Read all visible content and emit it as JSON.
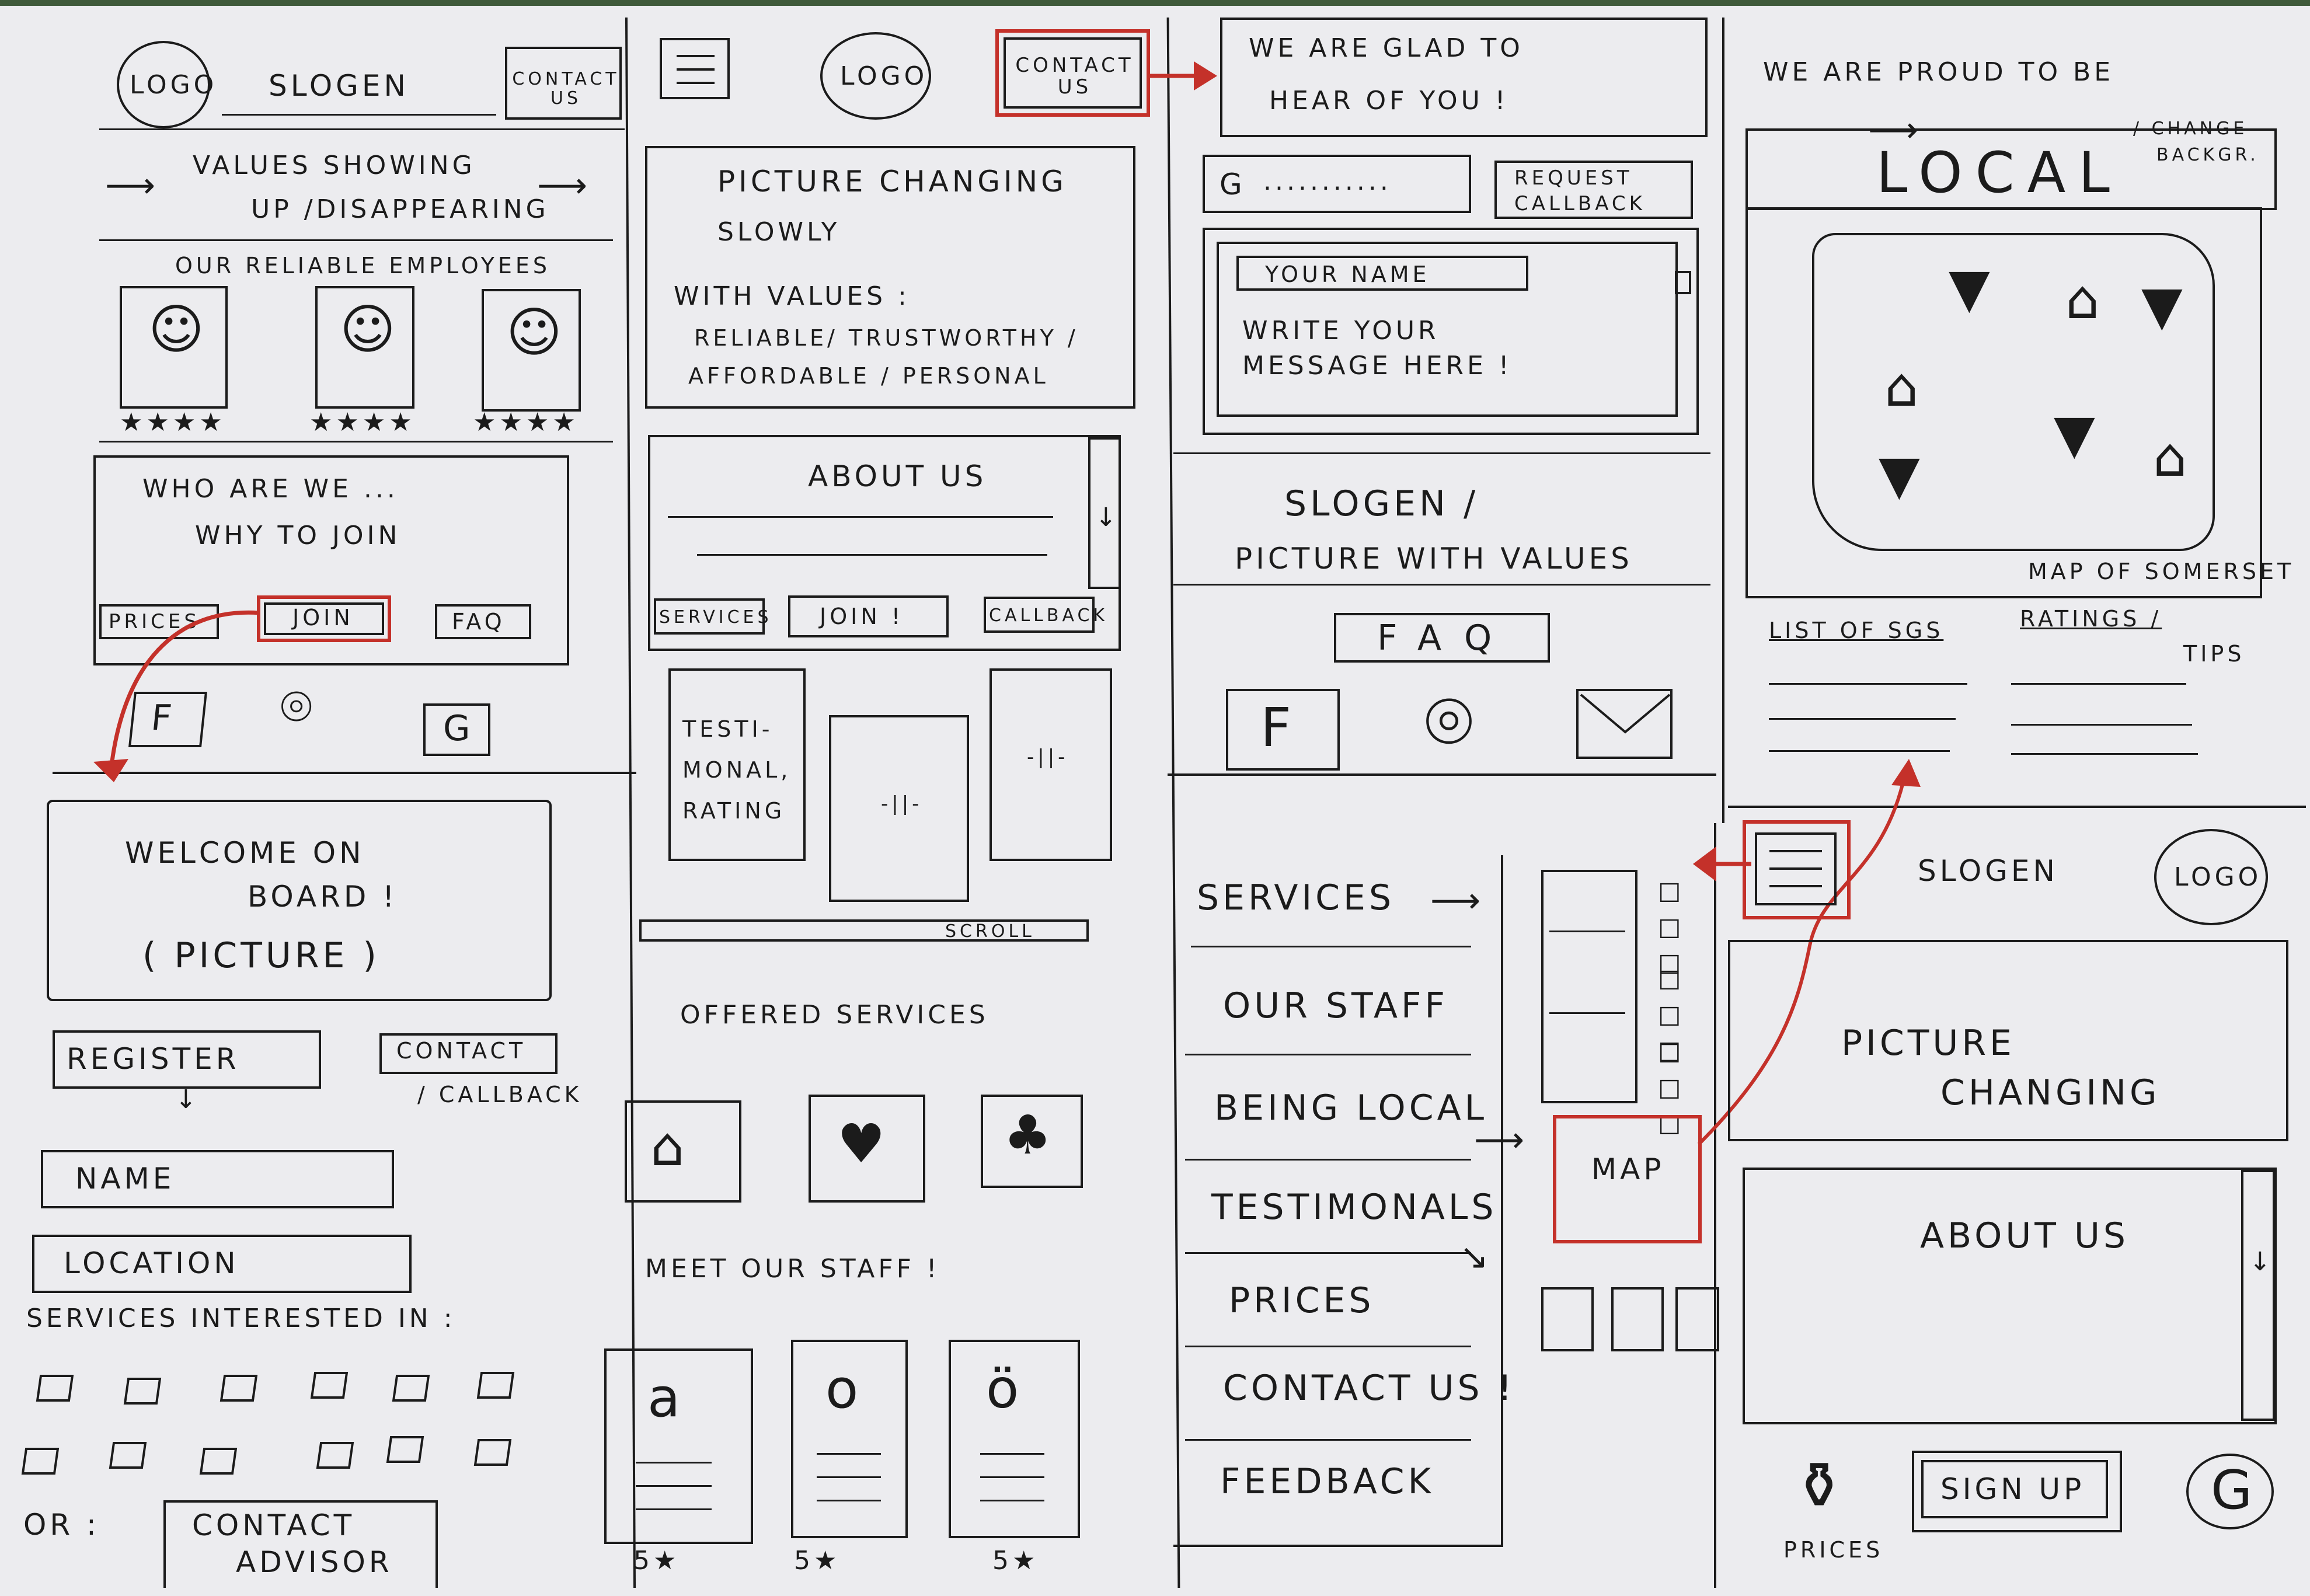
{
  "panel1": {
    "logo": "LOGO",
    "slogan": "SLOGEN",
    "contact": "CONTACT US",
    "values_line1": "VALUES SHOWING",
    "values_line2": "UP /DISAPPEARING",
    "employees_title": "OUR RELIABLE EMPLOYEES",
    "who_line1": "WHO ARE WE ...",
    "who_line2": "WHY TO JOIN",
    "btn_prices": "PRICES",
    "btn_join": "JOIN",
    "btn_faq": "FAQ"
  },
  "panel2": {
    "logo": "LOGO",
    "contact": "CONTACT US",
    "picture_line1": "PICTURE CHANGING",
    "picture_line2": "SLOWLY",
    "with_values": "WITH VALUES :",
    "values_line1": "RELIABLE/ TRUSTWORTHY /",
    "values_line2": "AFFORDABLE / PERSONAL",
    "about": "ABOUT US",
    "btn_services": "SERVICES",
    "btn_join": "JOIN !",
    "btn_callback": "CALLBACK",
    "testimonial_line1": "TESTI-",
    "testimonial_line2": "MONAL,",
    "testimonial_line3": "RATING",
    "card_mark": "-||-",
    "scroll": "SCROLL",
    "offered": "OFFERED SERVICES",
    "meet": "MEET OUR STAFF !",
    "stars": [
      "5",
      "5",
      "5"
    ]
  },
  "panel3": {
    "glad_line1": "WE ARE GLAD TO",
    "glad_line2": "HEAR OF YOU !",
    "phone_placeholder": "...........",
    "request_line1": "REQUEST",
    "request_line2": "CALLBACK",
    "your_name": "YOUR NAME",
    "message_line1": "WRITE YOUR",
    "message_line2": "MESSAGE HERE !",
    "slogan_line1": "SLOGEN /",
    "slogan_line2": "PICTURE WITH VALUES",
    "faq": "FAQ"
  },
  "panel4": {
    "proud": "WE ARE PROUD TO BE",
    "local": "LOCAL",
    "change_line1": "/ CHANGE",
    "change_line2": "BACKGR.",
    "map_caption": "MAP OF SOMERSET",
    "list_heading": "LIST OF SGS",
    "ratings_line1": "RATINGS /",
    "ratings_line2": "TIPS"
  },
  "panel5": {
    "welcome_line1": "WELCOME ON",
    "welcome_line2": "BOARD !",
    "welcome_line3": "( PICTURE )",
    "register": "REGISTER",
    "contact_line1": "CONTACT",
    "contact_line2": "/ CALLBACK",
    "name_field": "NAME",
    "location_field": "LOCATION",
    "services_interested": "SERVICES INTERESTED IN :",
    "or_label": "OR :",
    "advisor_line1": "CONTACT",
    "advisor_line2": "ADVISOR"
  },
  "menu": {
    "items": [
      "SERVICES",
      "OUR STAFF",
      "BEING LOCAL",
      "TESTIMONALS",
      "PRICES",
      "CONTACT US !",
      "FEEDBACK"
    ],
    "map": "MAP"
  },
  "panel6": {
    "slogan": "SLOGEN",
    "logo": "LOGO",
    "picture_line1": "PICTURE",
    "picture_line2": "CHANGING",
    "about": "ABOUT US",
    "prices": "PRICES",
    "signup": "SIGN UP"
  },
  "colors": {
    "ink": "#1b1b1b",
    "accent_red": "#c4312a",
    "paper": "#ececef"
  }
}
